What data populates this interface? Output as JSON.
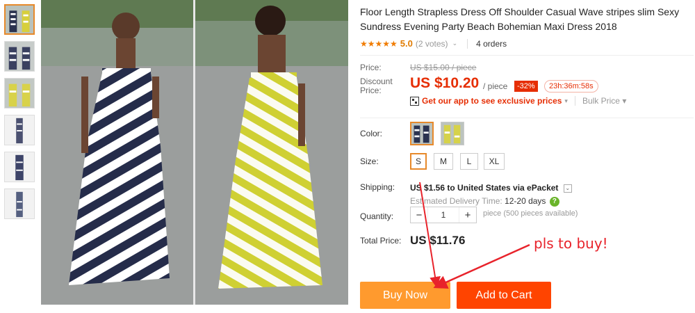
{
  "product": {
    "title": "Floor Length Strapless Dress Off Shoulder Casual Wave stripes slim Sexy Sundress Evening Party Beach Bohemian Maxi Dress 2018",
    "stars": "★★★★★",
    "score": "5.0",
    "votes": "(2 votes)",
    "orders": "4 orders"
  },
  "price": {
    "price_label": "Price:",
    "original": "US $15.00 / piece",
    "discount_label_1": "Discount",
    "discount_label_2": "Price:",
    "discount_price": "US $10.20",
    "per_piece": "/ piece",
    "off": "-32%",
    "timer": "23h:36m:58s",
    "app_promo": "Get our app to see exclusive prices",
    "bulk": "Bulk Price"
  },
  "options": {
    "color_label": "Color:",
    "size_label": "Size:",
    "sizes": [
      "S",
      "M",
      "L",
      "XL"
    ],
    "selected_size": "S",
    "shipping_label": "Shipping:",
    "shipping": "US $1.56 to United States via ePacket",
    "delivery_label": "Estimated Delivery Time:",
    "delivery_value": "12-20 days",
    "quantity_label": "Quantity:",
    "quantity": "1",
    "quantity_note": "piece (500 pieces available)",
    "total_label": "Total Price:",
    "total": "US $11.76"
  },
  "actions": {
    "buy_now": "Buy Now",
    "add_to_cart": "Add to Cart"
  },
  "annotation": "pls to buy!",
  "colors": {
    "accent": "#e62e04",
    "buy_now": "#ff9a2e",
    "add_to_cart": "#ff4400",
    "annotation": "#e8232b"
  }
}
